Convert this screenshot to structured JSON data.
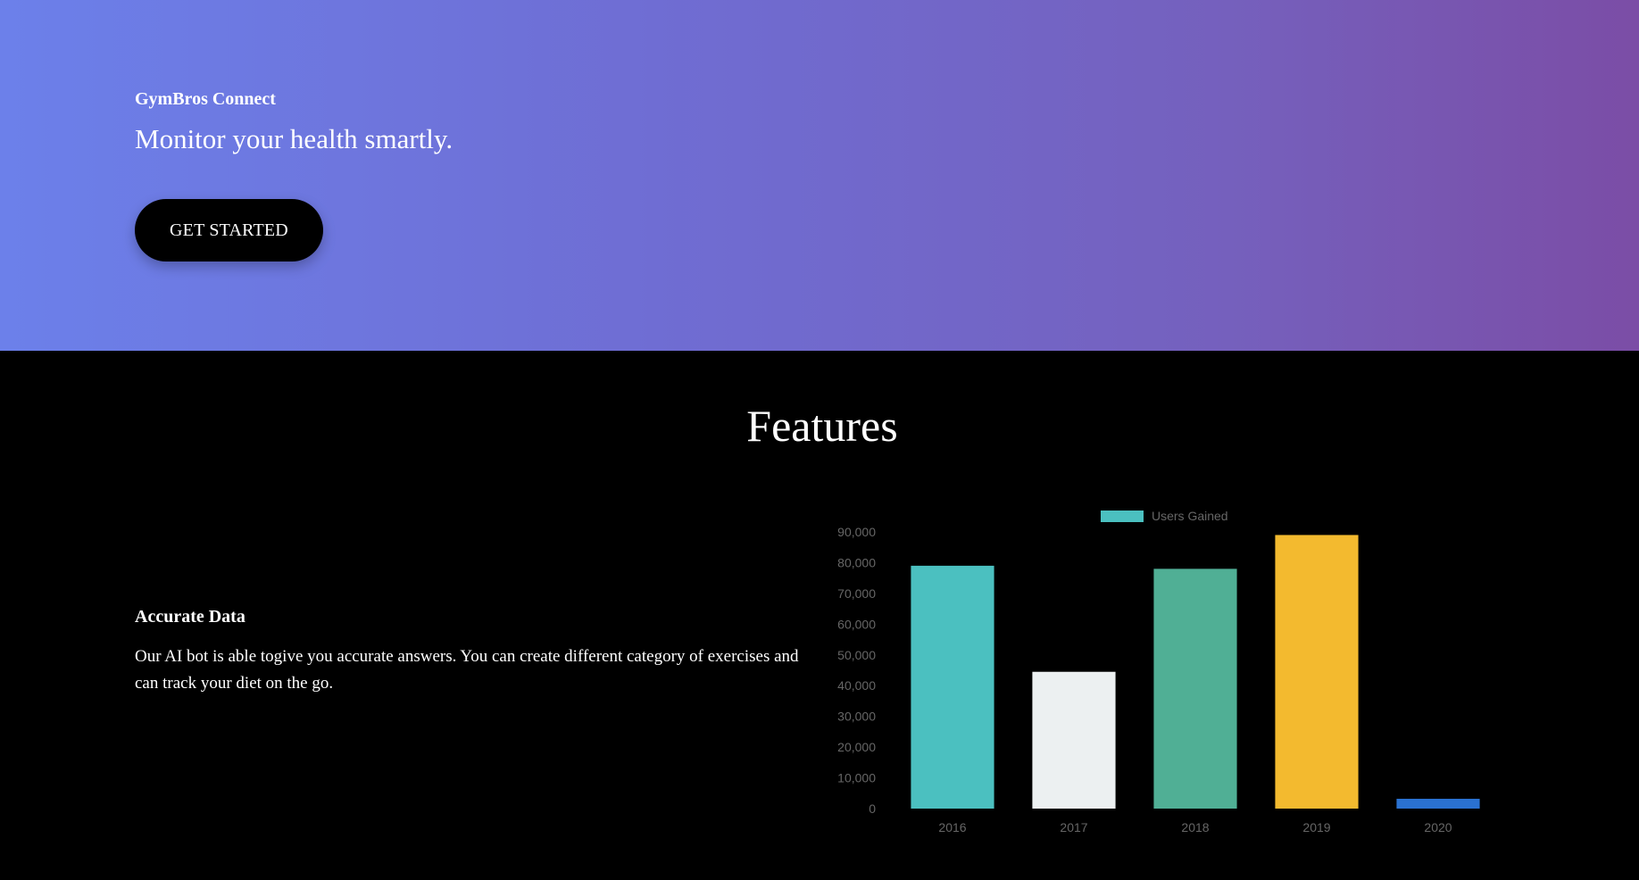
{
  "hero": {
    "brand": "GymBros Connect",
    "tagline": "Monitor your health smartly.",
    "cta_label": "GET STARTED"
  },
  "features": {
    "title": "Features",
    "item": {
      "heading": "Accurate Data",
      "description": "Our AI bot is able togive you accurate answers. You can create different category of exercises and can track your diet on the go."
    }
  },
  "colors": {
    "hero_gradient_start": "#6c80ea",
    "hero_gradient_end": "#7b4da6",
    "background": "#000000"
  },
  "chart_data": {
    "type": "bar",
    "categories": [
      "2016",
      "2017",
      "2018",
      "2019",
      "2020"
    ],
    "series": [
      {
        "name": "Users Gained",
        "values": [
          79000,
          44500,
          78000,
          89000,
          3200
        ]
      }
    ],
    "bar_colors": [
      "#4bc0c0",
      "#ecf0f1",
      "#50af95",
      "#f3ba2f",
      "#2a71d0"
    ],
    "legend_color": "#4bc0c0",
    "ylim": [
      0,
      90000
    ],
    "yticks": [
      "0",
      "10,000",
      "20,000",
      "30,000",
      "40,000",
      "50,000",
      "60,000",
      "70,000",
      "80,000",
      "90,000"
    ],
    "ytick_values": [
      0,
      10000,
      20000,
      30000,
      40000,
      50000,
      60000,
      70000,
      80000,
      90000
    ],
    "legend_position": "top",
    "grid": false
  }
}
